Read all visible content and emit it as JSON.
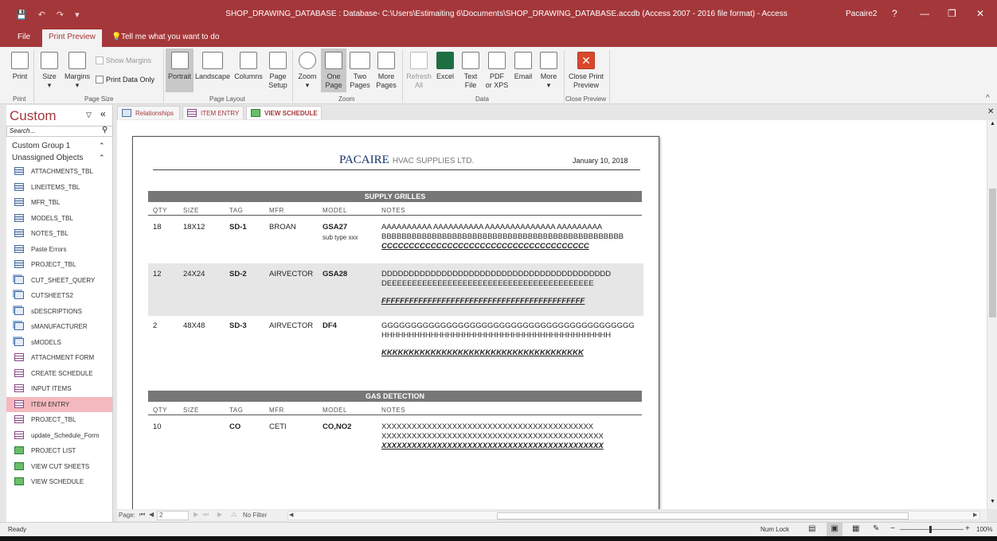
{
  "window": {
    "title": "SHOP_DRAWING_DATABASE : Database- C:\\Users\\Estimaiting 6\\Documents\\SHOP_DRAWING_DATABASE.accdb (Access 2007 - 2016 file format) - Access",
    "user": "Pacaire2",
    "help": "?"
  },
  "ribbon_tabs": {
    "file": "File",
    "print_preview": "Print Preview",
    "tell_me": "Tell me what you want to do"
  },
  "ribbon": {
    "print": "Print",
    "size": "Size",
    "margins": "Margins",
    "show_margins": "Show Margins",
    "print_data_only": "Print Data Only",
    "portrait": "Portrait",
    "landscape": "Landscape",
    "columns": "Columns",
    "page_setup_1": "Page",
    "page_setup_2": "Setup",
    "zoom": "Zoom",
    "one_page_1": "One",
    "one_page_2": "Page",
    "two_pages_1": "Two",
    "two_pages_2": "Pages",
    "more_pages_1": "More",
    "more_pages_2": "Pages",
    "refresh_all_1": "Refresh",
    "refresh_all_2": "All",
    "excel": "Excel",
    "text_file_1": "Text",
    "text_file_2": "File",
    "pdf_1": "PDF",
    "pdf_2": "or XPS",
    "email": "Email",
    "more": "More",
    "close_preview_1": "Close Print",
    "close_preview_2": "Preview",
    "groups": {
      "print": "Print",
      "page_size": "Page Size",
      "page_layout": "Page Layout",
      "zoom": "Zoom",
      "data": "Data",
      "close_preview": "Close Preview"
    }
  },
  "nav": {
    "title": "Custom",
    "search_placeholder": "Search...",
    "group1": "Custom Group 1",
    "group2": "Unassigned Objects",
    "items": [
      {
        "label": "ATTACHMENTS_TBL",
        "type": "table"
      },
      {
        "label": "LINEITEMS_TBL",
        "type": "table"
      },
      {
        "label": "MFR_TBL",
        "type": "table"
      },
      {
        "label": "MODELS_TBL",
        "type": "table"
      },
      {
        "label": "NOTES_TBL",
        "type": "table"
      },
      {
        "label": "Paste Errors",
        "type": "table"
      },
      {
        "label": "PROJECT_TBL",
        "type": "table"
      },
      {
        "label": "CUT_SHEET_QUERY",
        "type": "query"
      },
      {
        "label": "CUTSHEETS2",
        "type": "query"
      },
      {
        "label": "sDESCRIPTIONS",
        "type": "query"
      },
      {
        "label": "sMANUFACTURER",
        "type": "query"
      },
      {
        "label": "sMODELS",
        "type": "query"
      },
      {
        "label": "ATTACHMENT FORM",
        "type": "form"
      },
      {
        "label": "CREATE SCHEDULE",
        "type": "form"
      },
      {
        "label": "INPUT ITEMS",
        "type": "form"
      },
      {
        "label": "ITEM ENTRY",
        "type": "form"
      },
      {
        "label": "PROJECT_TBL",
        "type": "form"
      },
      {
        "label": "update_Schedule_Form",
        "type": "form"
      },
      {
        "label": "PROJECT LIST",
        "type": "report"
      },
      {
        "label": "VIEW CUT SHEETS",
        "type": "report"
      },
      {
        "label": "VIEW SCHEDULE",
        "type": "report"
      }
    ]
  },
  "doc_tabs": {
    "relationships": "Relationships",
    "item_entry": "ITEM ENTRY",
    "view_schedule": "VIEW SCHEDULE"
  },
  "report": {
    "company": "PACAIRE",
    "company_sub": "HVAC SUPPLIES LTD.",
    "date": "January 10, 2018",
    "columns": [
      "QTY",
      "SIZE",
      "TAG",
      "MFR",
      "MODEL",
      "NOTES"
    ],
    "sections": [
      {
        "name": "SUPPLY GRILLES",
        "rows": [
          {
            "qty": "18",
            "size": "18X12",
            "tag": "SD-1",
            "mfr": "BROAN",
            "model": "GSA27",
            "subtype": "sub type xxx",
            "note1": "AAAAAAAAAA AAAAAAAAAA AAAAAAAAAAAAAA AAAAAAAAA",
            "note2": "BBBBBBBBBBBBBBBBBBBBBBBBBBBBBBBBBBBBBBBBBBBBBBBB",
            "note3": "CCCCCCCCCCCCCCCCCCCCCCCCCCCCCCCCCCCCCC"
          },
          {
            "qty": "12",
            "size": "24X24",
            "tag": "SD-2",
            "mfr": "AIRVECTOR",
            "model": "GSA28",
            "subtype": "",
            "note1": "DDDDDDDDDDDDDDDDDDDDDDDDDDDDDDDDDDDDDDDDDD",
            "note2": "DEEEEEEEEEEEEEEEEEEEEEEEEEEEEEEEEEEEEEEEEE",
            "note3": "FFFFFFFFFFFFFFFFFFFFFFFFFFFFFFFFFFFFFFFFFFFF"
          },
          {
            "qty": "2",
            "size": "48X48",
            "tag": "SD-3",
            "mfr": "AIRVECTOR",
            "model": "DF4",
            "subtype": "",
            "note1": "GGGGGGGGGGGGGGGGGGGGGGGGGGGGGGGGGGGGGGGGGGG",
            "note2": "HHHHHHHHHHHHHHHHHHHHHHHHHHHHHHHHHHHHHHHHHH",
            "note3": "KKKKKKKKKKKKKKKKKKKKKKKKKKKKKKKKKKKKK"
          }
        ]
      },
      {
        "name": "GAS DETECTION",
        "rows": [
          {
            "qty": "10",
            "size": "",
            "tag": "CO",
            "mfr": "CETI",
            "model": "CO,NO2",
            "subtype": "",
            "note1": "XXXXXXXXXXXXXXXXXXXXXXXXXXXXXXXXXXXXXXXXXX",
            "note2": "XXXXXXXXXXXXXXXXXXXXXXXXXXXXXXXXXXXXXXXXXXXX",
            "note3": "XXXXXXXXXXXXXXXXXXXXXXXXXXXXXXXXXXXXXXXXXXXX"
          }
        ]
      }
    ]
  },
  "record_nav": {
    "label": "Page:",
    "page": "2",
    "filter": "No Filter"
  },
  "status": {
    "ready": "Ready",
    "num_lock": "Num Lock",
    "zoom": "100%"
  },
  "colors": {
    "accent": "#a4373a",
    "band": "#777777",
    "company": "#16326b"
  }
}
